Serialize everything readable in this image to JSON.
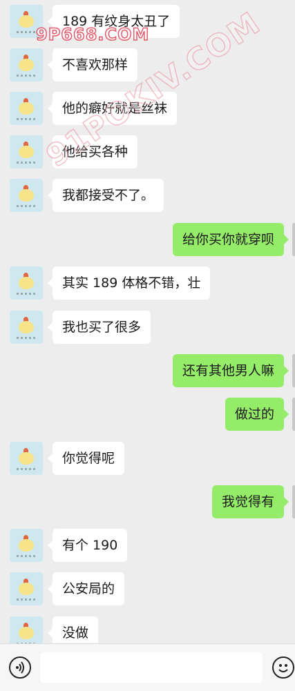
{
  "watermarks": {
    "primary": "9P668.COM",
    "diagonal": "91POKIV.COM"
  },
  "messages": [
    {
      "side": "in",
      "text": "189 有纹身太丑了"
    },
    {
      "side": "in",
      "text": "不喜欢那样"
    },
    {
      "side": "in",
      "text": "他的癖好就是丝袜"
    },
    {
      "side": "in",
      "text": "他给买各种"
    },
    {
      "side": "in",
      "text": "我都接受不了。"
    },
    {
      "side": "out",
      "text": "给你买你就穿呗"
    },
    {
      "side": "in",
      "text": "其实 189 体格不错，壮"
    },
    {
      "side": "in",
      "text": "我也买了很多"
    },
    {
      "side": "out",
      "text": "还有其他男人嘛"
    },
    {
      "side": "out",
      "text": "做过的"
    },
    {
      "side": "in",
      "text": "你觉得呢"
    },
    {
      "side": "out",
      "text": "我觉得有"
    },
    {
      "side": "in",
      "text": "有个 190"
    },
    {
      "side": "in",
      "text": "公安局的"
    },
    {
      "side": "in",
      "text": "没做"
    }
  ],
  "input": {
    "placeholder": ""
  },
  "icons": {
    "voice": "voice-icon",
    "emoji": "emoji-icon"
  },
  "colors": {
    "background": "#ededed",
    "incoming_bubble": "#ffffff",
    "outgoing_bubble": "#95ec69"
  }
}
